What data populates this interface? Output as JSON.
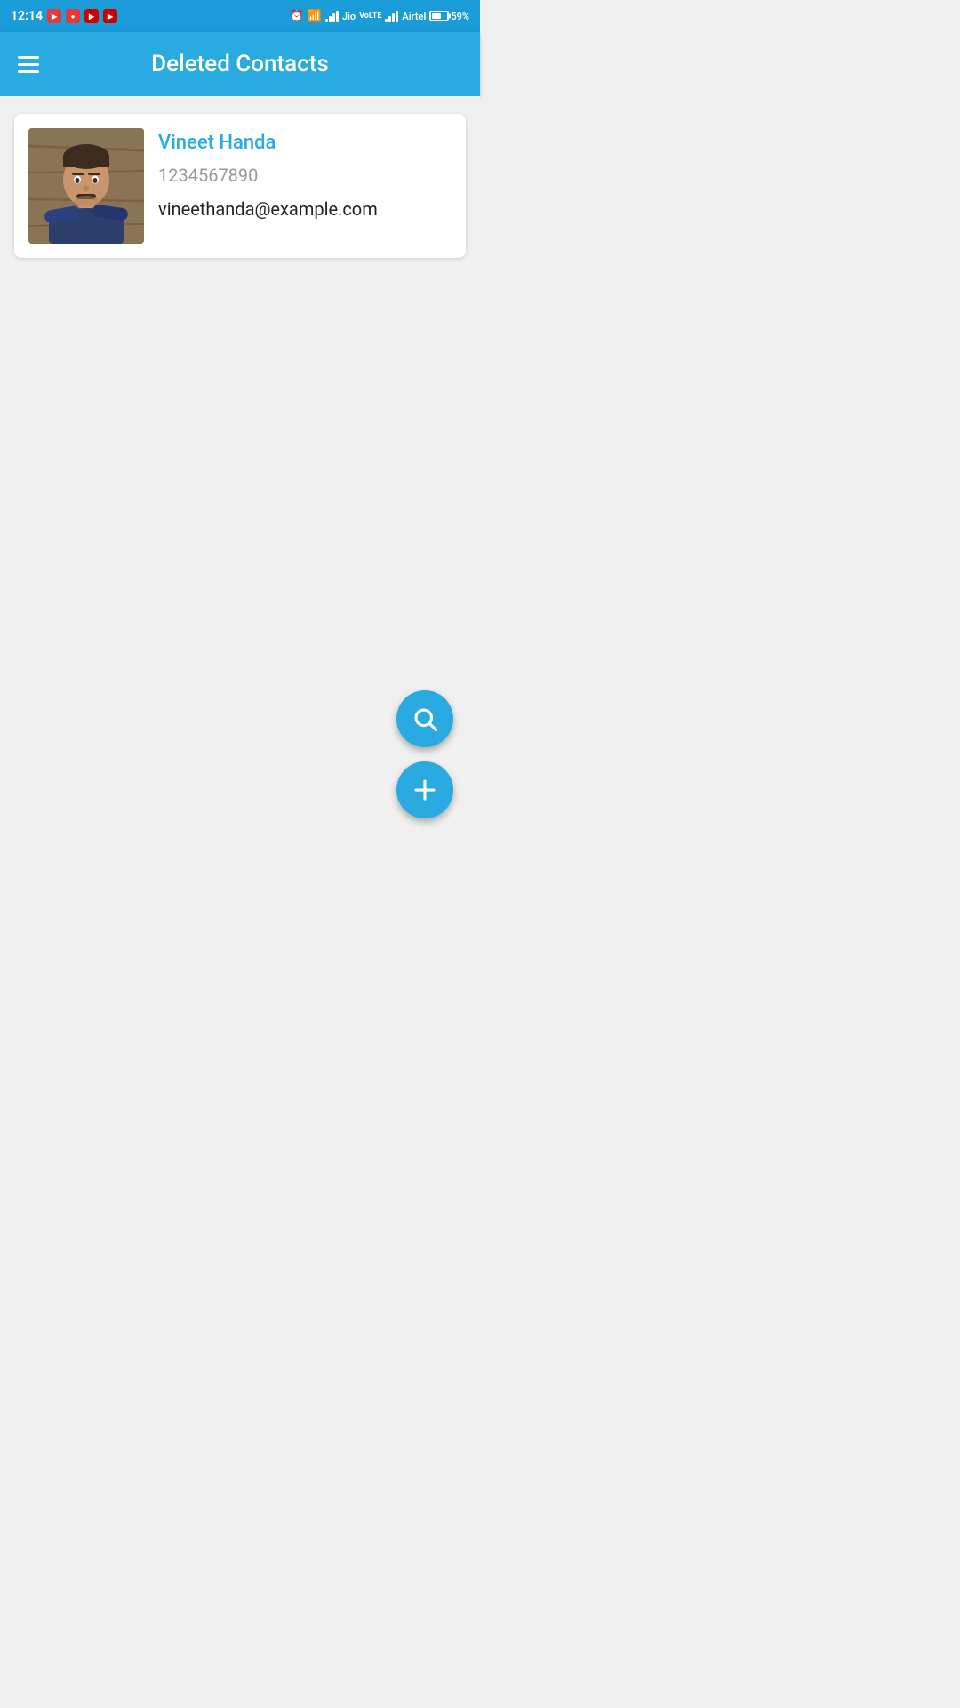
{
  "statusBar": {
    "time": "12:14",
    "carrier1": "Jio",
    "carrier2": "Airtel",
    "battery": "59%"
  },
  "header": {
    "title": "Deleted Contacts",
    "menuLabel": "Menu"
  },
  "contacts": [
    {
      "id": 1,
      "name": "Vineet Handa",
      "phone": "1234567890",
      "email": "vineethanda@example.com"
    }
  ],
  "fab": {
    "searchLabel": "Search",
    "addLabel": "Add"
  }
}
